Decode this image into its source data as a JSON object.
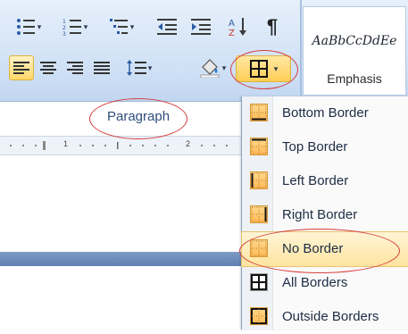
{
  "ribbon": {
    "paragraph_group_label": "Paragraph",
    "buttons": [
      {
        "name": "bullets",
        "icon": "bullets-icon",
        "has_arrow": true
      },
      {
        "name": "numbering",
        "icon": "numbering-icon",
        "has_arrow": true
      },
      {
        "name": "multilevel-list",
        "icon": "multilevel-list-icon",
        "has_arrow": true
      },
      {
        "name": "decrease-indent",
        "icon": "decrease-indent-icon",
        "has_arrow": false
      },
      {
        "name": "increase-indent",
        "icon": "increase-indent-icon",
        "has_arrow": false
      },
      {
        "name": "sort",
        "icon": "sort-az-icon",
        "has_arrow": false
      },
      {
        "name": "show-hide",
        "icon": "pilcrow-icon",
        "has_arrow": false
      }
    ],
    "styles": {
      "sample_text": "AaBbCcDdEe",
      "name": "Emphasis"
    }
  },
  "ruler": {
    "marks": [
      "1",
      "2"
    ]
  },
  "borders_menu": {
    "items": [
      {
        "label": "Bottom Border",
        "icon": "bottom-border-icon",
        "hover": false
      },
      {
        "label": "Top Border",
        "icon": "top-border-icon",
        "hover": false
      },
      {
        "label": "Left Border",
        "icon": "left-border-icon",
        "hover": false
      },
      {
        "label": "Right Border",
        "icon": "right-border-icon",
        "hover": false
      },
      {
        "label": "No Border",
        "icon": "no-border-icon",
        "hover": true
      },
      {
        "label": "All Borders",
        "icon": "all-borders-icon",
        "hover": false
      },
      {
        "label": "Outside Borders",
        "icon": "outside-borders-icon",
        "hover": false
      }
    ]
  },
  "colors": {
    "ribbon_bg": "#d6e5f7",
    "highlight": "#ffd86b",
    "annotation_red": "#d73d3d",
    "text": "#1d2d44"
  }
}
